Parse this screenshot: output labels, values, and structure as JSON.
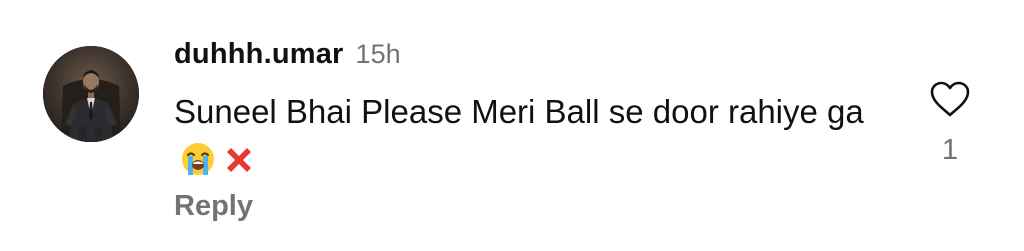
{
  "comment": {
    "username": "duhhh.umar",
    "time": "15h",
    "text": "Suneel Bhai Please Meri Ball se door rahiye ga",
    "emojis": [
      "loudly-crying-face-emoji",
      "cross-mark-emoji"
    ],
    "reply_label": "Reply",
    "like_count": "1"
  },
  "icons": {
    "like": "heart-icon"
  },
  "colors": {
    "primary_text": "#111111",
    "secondary_text": "#737373",
    "background": "#ffffff",
    "cross_mark": "#e53935"
  }
}
